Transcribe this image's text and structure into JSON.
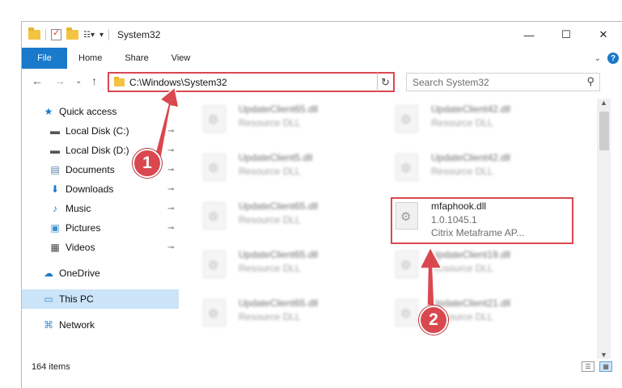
{
  "window": {
    "title": "System32"
  },
  "titlebar": {
    "minimize_glyph": "—",
    "maximize_glyph": "☐",
    "close_glyph": "✕"
  },
  "ribbon": {
    "tabs": [
      "File",
      "Home",
      "Share",
      "View"
    ],
    "help_glyph": "?",
    "expand_glyph": "⌄"
  },
  "nav": {
    "back_glyph": "←",
    "forward_glyph": "→",
    "recent_glyph": "⌄",
    "up_glyph": "↑"
  },
  "address": {
    "path": "C:\\Windows\\System32",
    "dropdown_glyph": "⌄",
    "refresh_glyph": "↻"
  },
  "search": {
    "placeholder": "Search System32",
    "icon_glyph": "⚲"
  },
  "sidebar": {
    "items": [
      {
        "label": "Quick access",
        "icon": "star-icon",
        "glyph": "★",
        "color": "#1979ca",
        "pinned": false
      },
      {
        "label": "Local Disk (C:)",
        "icon": "drive-icon",
        "glyph": "▬",
        "color": "#555555",
        "pinned": true
      },
      {
        "label": "Local Disk (D:)",
        "icon": "drive-icon",
        "glyph": "▬",
        "color": "#555555",
        "pinned": true
      },
      {
        "label": "Documents",
        "icon": "documents-icon",
        "glyph": "▤",
        "color": "#5b7fa8",
        "pinned": true
      },
      {
        "label": "Downloads",
        "icon": "downloads-icon",
        "glyph": "⬇",
        "color": "#1979ca",
        "pinned": true
      },
      {
        "label": "Music",
        "icon": "music-icon",
        "glyph": "♪",
        "color": "#1979ca",
        "pinned": true
      },
      {
        "label": "Pictures",
        "icon": "pictures-icon",
        "glyph": "▣",
        "color": "#3a8fd1",
        "pinned": true
      },
      {
        "label": "Videos",
        "icon": "videos-icon",
        "glyph": "▦",
        "color": "#444444",
        "pinned": true
      },
      {
        "label": "OneDrive",
        "icon": "onedrive-icon",
        "glyph": "☁",
        "color": "#1979ca",
        "pinned": false
      },
      {
        "label": "This PC",
        "icon": "this-pc-icon",
        "glyph": "▭",
        "color": "#3a8fd1",
        "pinned": false,
        "selected": true
      },
      {
        "label": "Network",
        "icon": "network-icon",
        "glyph": "⌘",
        "color": "#3a8fd1",
        "pinned": false
      }
    ],
    "pin_glyph": "📌"
  },
  "files": [
    {
      "name": "UpdateClient65.dll",
      "type": "Resource DLL"
    },
    {
      "name": "UpdateClient42.dll",
      "type": "Resource DLL"
    },
    {
      "name": "UpdateClient5.dll",
      "type": "Resource DLL"
    },
    {
      "name": "UpdateClient42.dll",
      "type": "Resource DLL"
    },
    {
      "name": "UpdateClient65.dll",
      "type": "Resource DLL"
    },
    {
      "name": "mfaphook.dll",
      "version": "1.0.1045.1",
      "type": "Citrix Metaframe AP...",
      "highlighted": true
    },
    {
      "name": "UpdateClient65.dll",
      "type": "Resource DLL"
    },
    {
      "name": "UpdateClient19.dll",
      "type": "Resource DLL"
    },
    {
      "name": "UpdateClient65.dll",
      "type": "Resource DLL"
    },
    {
      "name": "UpdateClient21.dll",
      "type": "Resource DLL"
    }
  ],
  "status": {
    "item_count": "164 items"
  },
  "callouts": [
    {
      "number": "1",
      "color": "#d9484f"
    },
    {
      "number": "2",
      "color": "#d9484f"
    }
  ]
}
